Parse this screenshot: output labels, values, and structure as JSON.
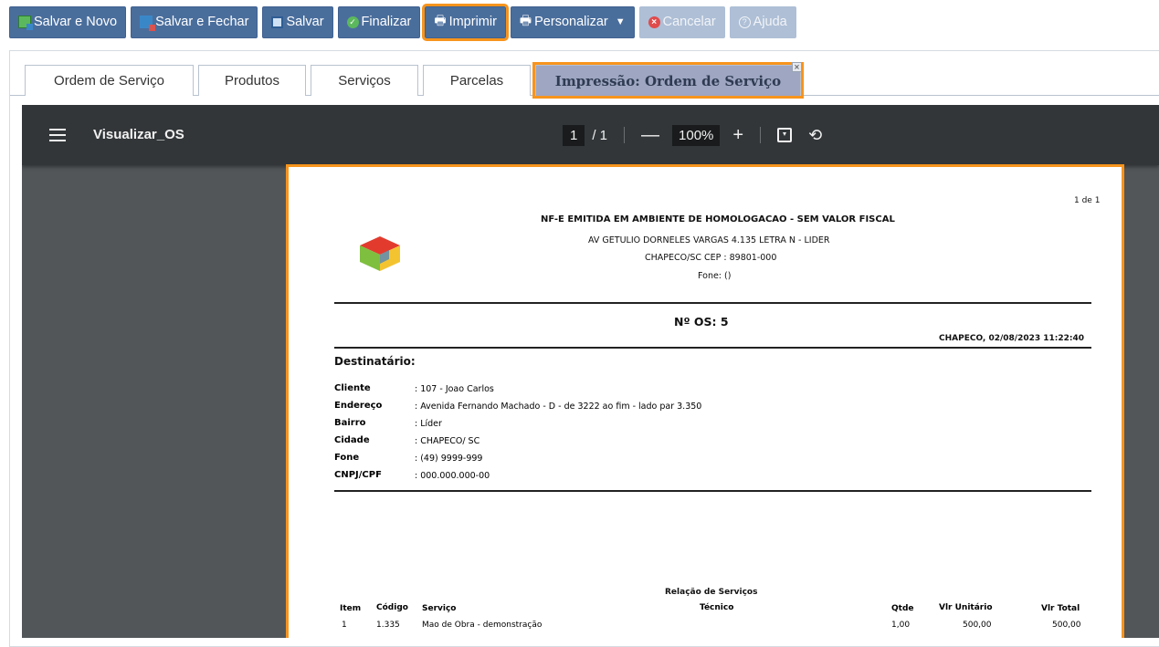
{
  "toolbar": {
    "save_new": "Salvar e Novo",
    "save_close": "Salvar e Fechar",
    "save": "Salvar",
    "finish": "Finalizar",
    "print": "Imprimir",
    "customize": "Personalizar",
    "cancel": "Cancelar",
    "help": "Ajuda"
  },
  "tabs": [
    {
      "label": "Ordem de Serviço"
    },
    {
      "label": "Produtos"
    },
    {
      "label": "Serviços"
    },
    {
      "label": "Parcelas"
    },
    {
      "label": "Impressão: Ordem de Serviço"
    }
  ],
  "viewer": {
    "title": "Visualizar_OS",
    "page_current": "1",
    "page_total": "/ 1",
    "zoom": "100%"
  },
  "doc": {
    "page_count": "1 de 1",
    "header": "NF-E EMITIDA EM AMBIENTE DE HOMOLOGACAO - SEM VALOR FISCAL",
    "address": "AV GETULIO DORNELES VARGAS 4.135  LETRA N  - LIDER",
    "city_cep": "CHAPECO/SC     CEP : 89801-000",
    "phone": "Fone: ()",
    "os_number": "Nº OS: 5",
    "date_place": "CHAPECO, 02/08/2023  11:22:40",
    "recipient_title": "Destinatário:",
    "fields": [
      {
        "label": "Cliente",
        "value": ": 107 - Joao Carlos"
      },
      {
        "label": "Endereço",
        "value": ": Avenida Fernando Machado - D - de 3222 ao fim - lado par 3.350"
      },
      {
        "label": "Bairro",
        "value": ": Líder"
      },
      {
        "label": "Cidade",
        "value": ": CHAPECO/   SC"
      },
      {
        "label": "Fone",
        "value": ": (49) 9999-999"
      },
      {
        "label": "CNPJ/CPF",
        "value": ": 000.000.000-00"
      }
    ],
    "services_title": "Relação de Serviços",
    "columns": {
      "item": "Item",
      "code": "Código",
      "service": "Serviço",
      "tech": "Técnico",
      "qty": "Qtde",
      "unit": "Vlr Unitário",
      "total": "Vlr Total"
    },
    "rows": [
      {
        "item": "1",
        "code": "1.335",
        "service": "Mao de Obra - demonstração",
        "tech": "",
        "qty": "1,00",
        "unit": "500,00",
        "total": "500,00"
      }
    ]
  }
}
